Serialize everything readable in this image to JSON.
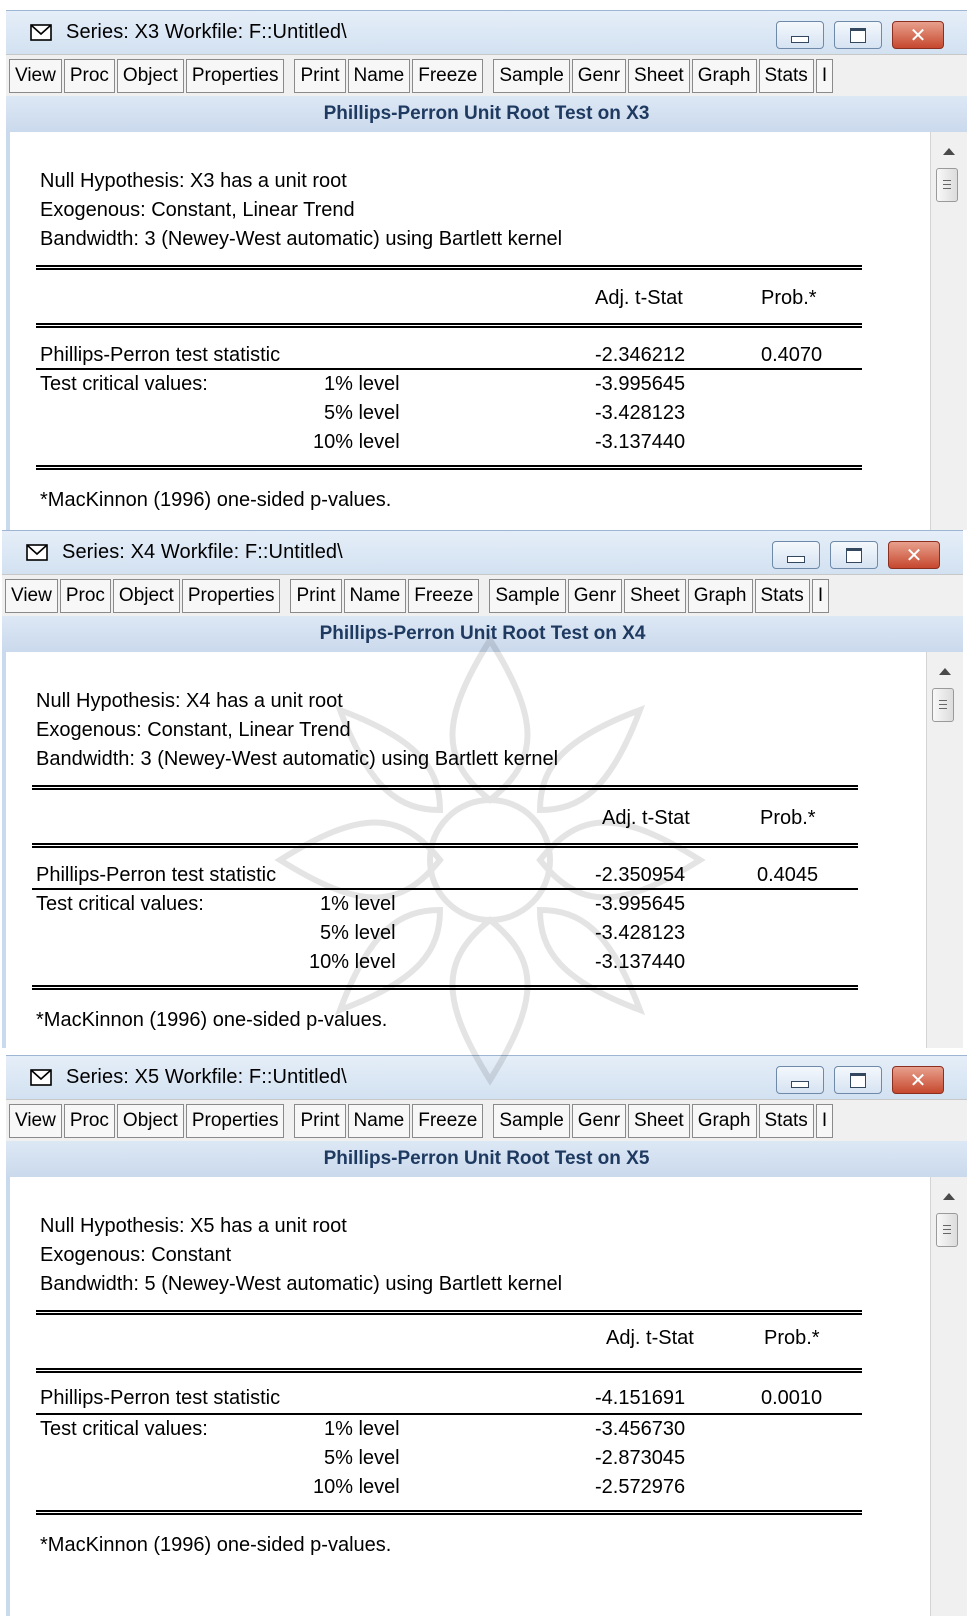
{
  "windows": [
    {
      "title": "Series: X3   Workfile: F::Untitled\\",
      "toolbar": [
        "View",
        "Proc",
        "Object",
        "Properties",
        "Print",
        "Name",
        "Freeze",
        "Sample",
        "Genr",
        "Sheet",
        "Graph",
        "Stats",
        "I"
      ],
      "header": "Phillips-Perron Unit Root Test on X3",
      "null_hypothesis": "Null Hypothesis: X3 has a unit root",
      "exogenous": "Exogenous: Constant, Linear Trend",
      "bandwidth": "Bandwidth: 3 (Newey-West automatic) using Bartlett kernel",
      "col_tstat": "Adj. t-Stat",
      "col_prob": "Prob.*",
      "stat_label": "Phillips-Perron test statistic",
      "stat_value": "-2.346212",
      "stat_prob": "0.4070",
      "crit_label": "Test critical values:",
      "levels": [
        {
          "label": "1% level",
          "value": "-3.995645"
        },
        {
          "label": "5% level",
          "value": "-3.428123"
        },
        {
          "label": "10% level",
          "value": "-3.137440"
        }
      ],
      "footnote": "*MacKinnon (1996) one-sided p-values."
    },
    {
      "title": "Series: X4   Workfile: F::Untitled\\",
      "toolbar": [
        "View",
        "Proc",
        "Object",
        "Properties",
        "Print",
        "Name",
        "Freeze",
        "Sample",
        "Genr",
        "Sheet",
        "Graph",
        "Stats",
        "I"
      ],
      "header": "Phillips-Perron Unit Root Test on X4",
      "null_hypothesis": "Null Hypothesis: X4 has a unit root",
      "exogenous": "Exogenous: Constant, Linear Trend",
      "bandwidth": "Bandwidth: 3 (Newey-West automatic) using Bartlett kernel",
      "col_tstat": "Adj. t-Stat",
      "col_prob": "Prob.*",
      "stat_label": "Phillips-Perron test statistic",
      "stat_value": "-2.350954",
      "stat_prob": "0.4045",
      "crit_label": "Test critical values:",
      "levels": [
        {
          "label": "1% level",
          "value": "-3.995645"
        },
        {
          "label": "5% level",
          "value": "-3.428123"
        },
        {
          "label": "10% level",
          "value": "-3.137440"
        }
      ],
      "footnote": "*MacKinnon (1996) one-sided p-values."
    },
    {
      "title": "Series: X5   Workfile: F::Untitled\\",
      "toolbar": [
        "View",
        "Proc",
        "Object",
        "Properties",
        "Print",
        "Name",
        "Freeze",
        "Sample",
        "Genr",
        "Sheet",
        "Graph",
        "Stats",
        "I"
      ],
      "header": "Phillips-Perron Unit Root Test on X5",
      "null_hypothesis": "Null Hypothesis: X5 has a unit root",
      "exogenous": "Exogenous: Constant",
      "bandwidth": "Bandwidth: 5 (Newey-West automatic) using Bartlett kernel",
      "col_tstat": "Adj. t-Stat",
      "col_prob": "Prob.*",
      "stat_label": "Phillips-Perron test statistic",
      "stat_value": "-4.151691",
      "stat_prob": "0.0010",
      "crit_label": "Test critical values:",
      "levels": [
        {
          "label": "1% level",
          "value": "-3.456730"
        },
        {
          "label": "5% level",
          "value": "-2.873045"
        },
        {
          "label": "10% level",
          "value": "-2.572976"
        }
      ],
      "footnote": "*MacKinnon (1996) one-sided p-values."
    }
  ]
}
